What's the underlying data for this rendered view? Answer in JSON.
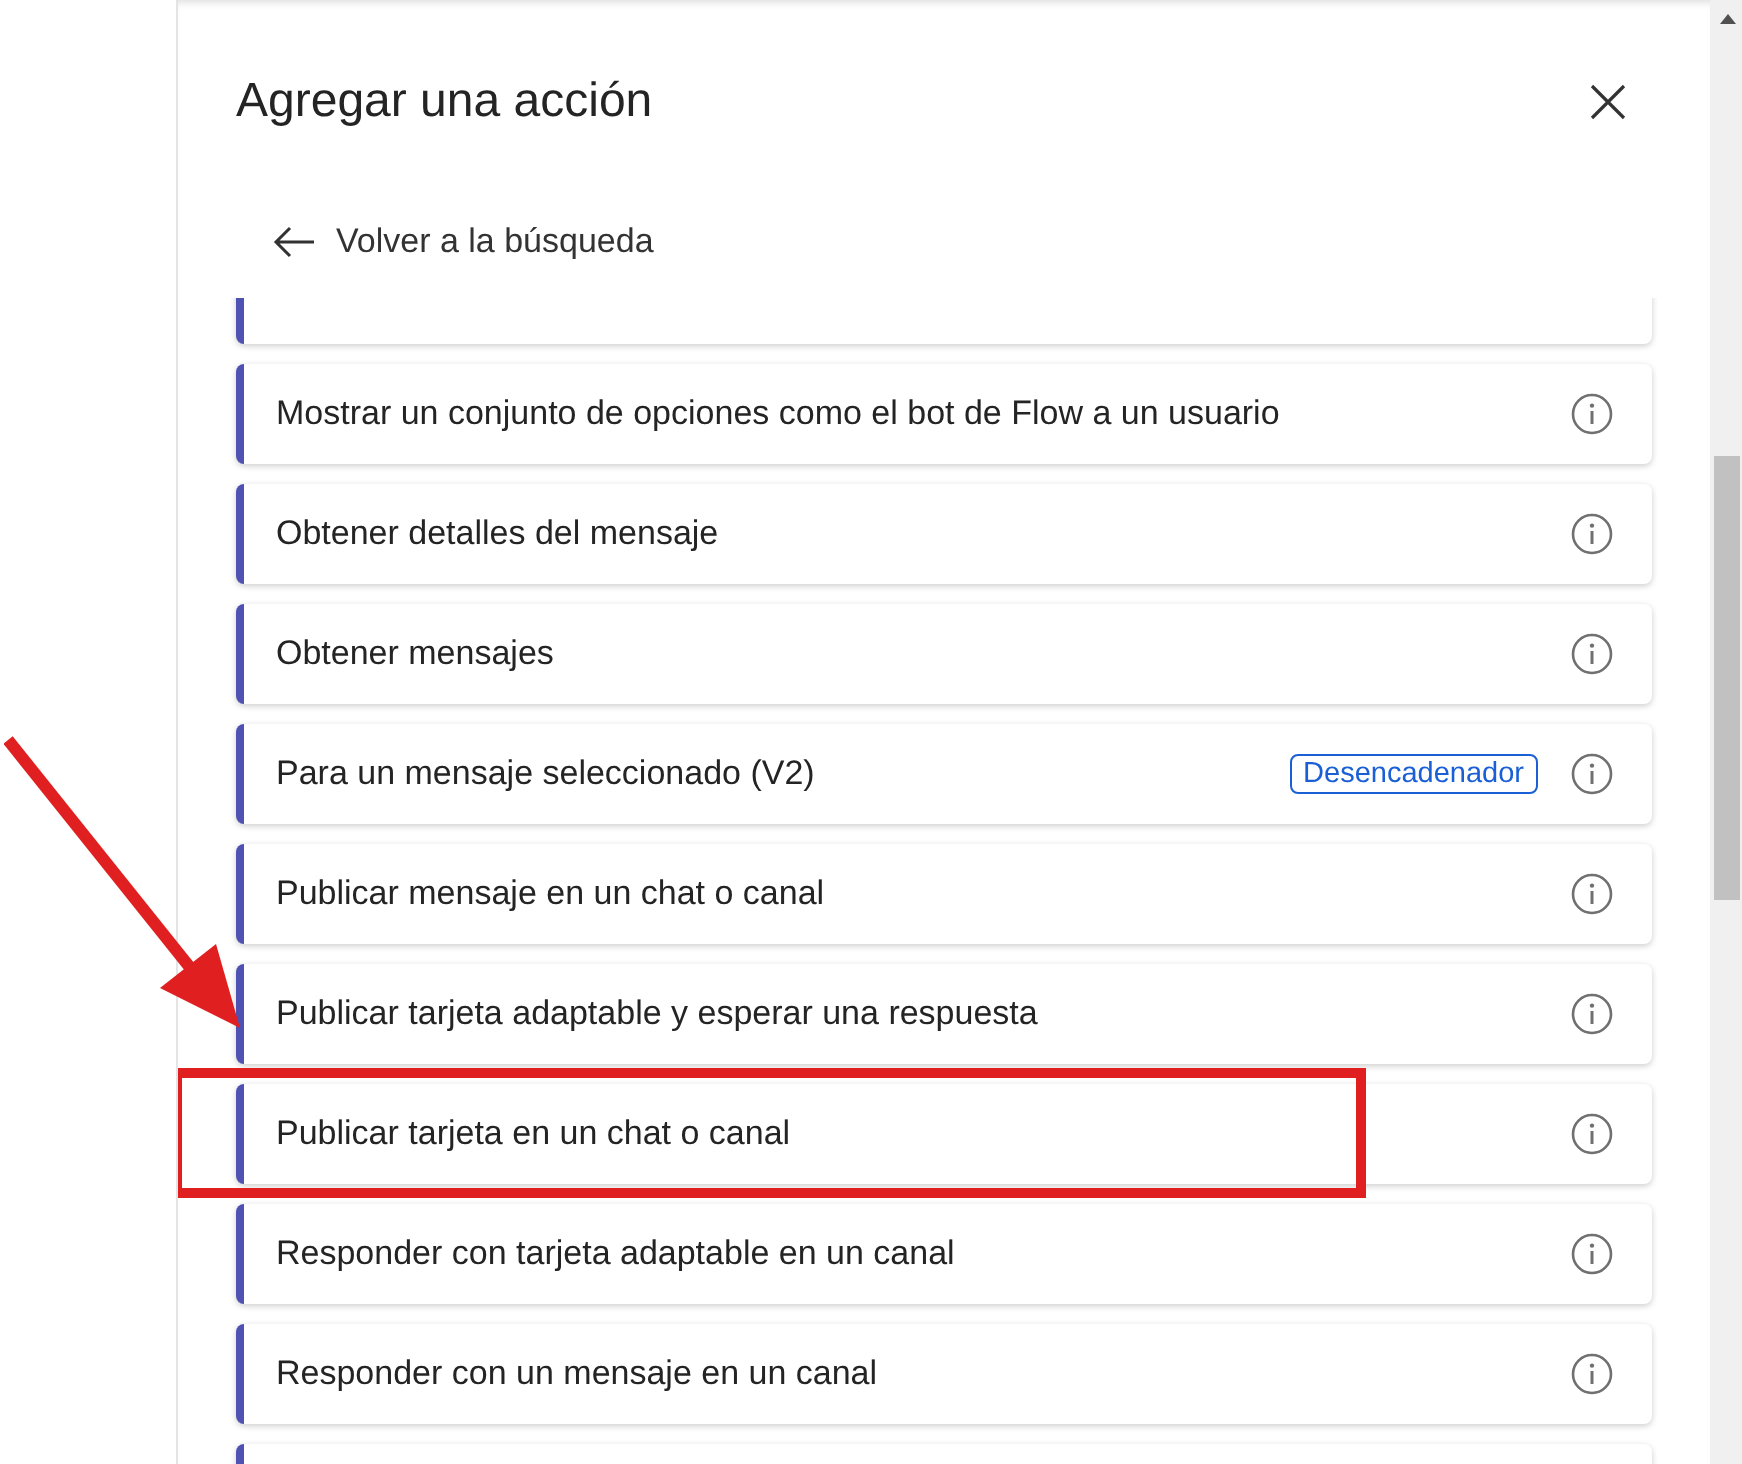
{
  "panel": {
    "title": "Agregar una acción",
    "back_link": "Volver a la búsqueda"
  },
  "actions": [
    {
      "label": "Mostrar un conjunto de opciones como el bot de Flow a un usuario",
      "highlighted": false
    },
    {
      "label": "Obtener detalles del mensaje",
      "highlighted": false
    },
    {
      "label": "Obtener mensajes",
      "highlighted": false
    },
    {
      "label": "Para un mensaje seleccionado (V2)",
      "badge": "Desencadenador",
      "highlighted": false
    },
    {
      "label": "Publicar mensaje en un chat o canal",
      "highlighted": false
    },
    {
      "label": "Publicar tarjeta adaptable y esperar una respuesta",
      "highlighted": false
    },
    {
      "label": "Publicar tarjeta en un chat o canal",
      "highlighted": true
    },
    {
      "label": "Responder con tarjeta adaptable en un canal",
      "highlighted": false
    },
    {
      "label": "Responder con un mensaje en un canal",
      "highlighted": false
    }
  ]
}
